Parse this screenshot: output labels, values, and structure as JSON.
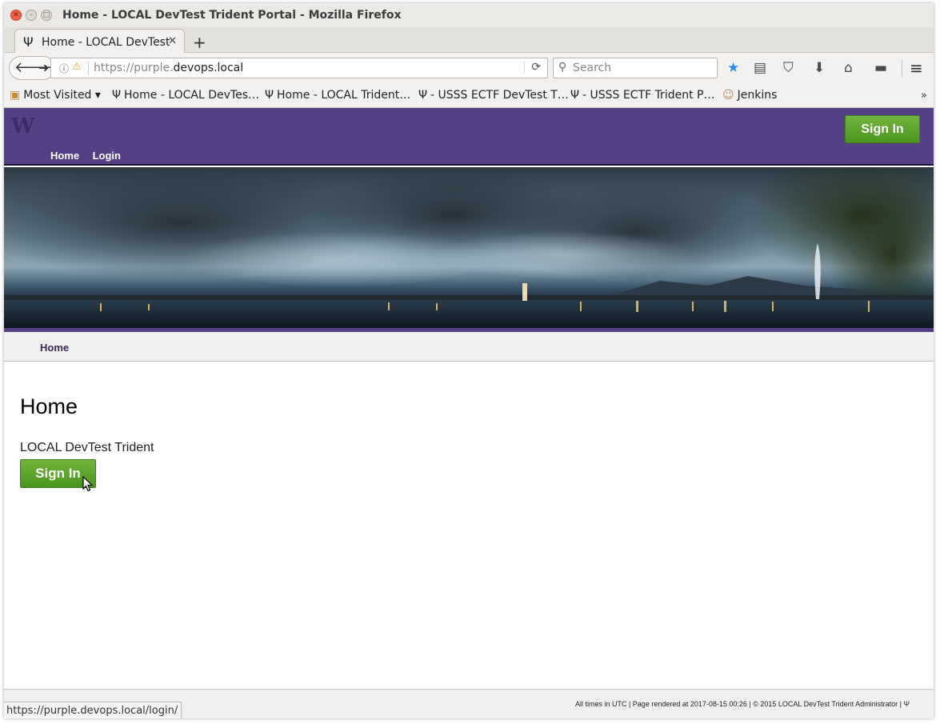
{
  "window": {
    "title": "Home - LOCAL DevTest Trident Portal - Mozilla Firefox"
  },
  "tabs": [
    {
      "label": "Home - LOCAL DevTest",
      "icon": "trident-icon",
      "active": true
    }
  ],
  "toolbar": {
    "url_prefix": "https://purple.",
    "url_domain": "devops.local",
    "search_placeholder": "Search"
  },
  "bookmarks": [
    {
      "label": "Most Visited ▾",
      "icon": "folder-icon"
    },
    {
      "label": "Home - LOCAL DevTes…",
      "icon": "trident-icon"
    },
    {
      "label": "Home - LOCAL Trident…",
      "icon": "trident-icon"
    },
    {
      "label": "- USSS ECTF DevTest T…",
      "icon": "trident-icon"
    },
    {
      "label": "- USSS ECTF Trident P…",
      "icon": "trident-icon"
    },
    {
      "label": "Jenkins",
      "icon": "jenkins-icon"
    }
  ],
  "site": {
    "logo": "W",
    "nav": [
      {
        "label": "Home"
      },
      {
        "label": "Login"
      }
    ],
    "header_signin": "Sign In",
    "breadcrumb": "Home",
    "page_title": "Home",
    "site_name": "LOCAL DevTest Trident",
    "main_signin": "Sign In",
    "footer": "All times in UTC | Page rendered at 2017-08-15 00:26 | © 2015 LOCAL DevTest Trident Administrator | Ψ"
  },
  "status_bar": {
    "url": "https://purple.devops.local/login/"
  },
  "colors": {
    "header": "#553f85",
    "button": "#5aa52a"
  }
}
